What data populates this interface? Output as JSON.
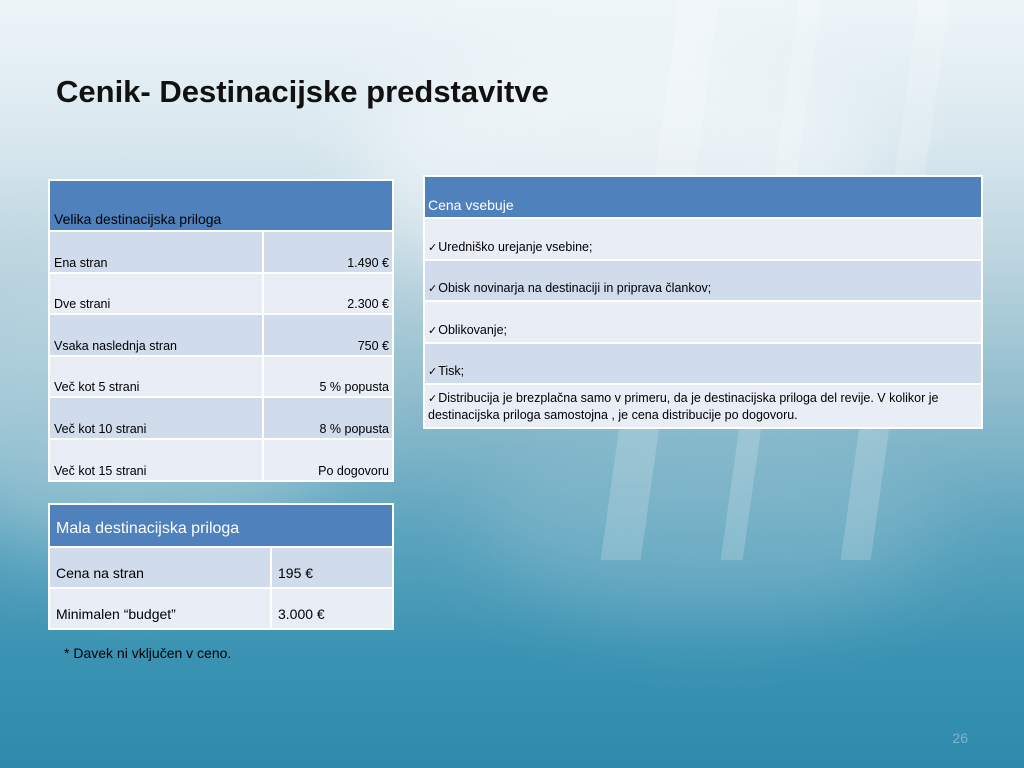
{
  "slide": {
    "title": "Cenik- Destinacijske predstavitve",
    "note": "* Davek ni vključen v ceno.",
    "page_number": "26"
  },
  "velika": {
    "header": "Velika destinacijska priloga",
    "rows": [
      {
        "label": "Ena stran",
        "value": "1.490 €"
      },
      {
        "label": "Dve strani",
        "value": "2.300 €"
      },
      {
        "label": "Vsaka naslednja stran",
        "value": "750 €"
      },
      {
        "label": "Več kot 5 strani",
        "value": "5 % popusta"
      },
      {
        "label": "Več kot 10 strani",
        "value": "8 % popusta"
      },
      {
        "label": "Več kot 15 strani",
        "value": "Po dogovoru"
      }
    ]
  },
  "mala": {
    "header": "Mala destinacijska priloga",
    "rows": [
      {
        "label": "Cena na stran",
        "value": "195 €"
      },
      {
        "label": "Minimalen “budget”",
        "value": "3.000 €"
      }
    ]
  },
  "cena": {
    "header": "Cena vsebuje",
    "check_icon": "checkmark-icon",
    "items": [
      "Uredniško urejanje vsebine;",
      "Obisk novinarja na destinaciji in priprava člankov;",
      "Oblikovanje;",
      "Tisk;",
      "Distribucija je brezplačna samo v primeru, da je destinacijska priloga del revije.  V kolikor je destinacijska priloga samostojna , je cena distribucije po dogovoru."
    ]
  },
  "colors": {
    "header_bg": "#4f81bd",
    "row_dark": "#d0dcec",
    "row_light": "#e9eef6"
  }
}
